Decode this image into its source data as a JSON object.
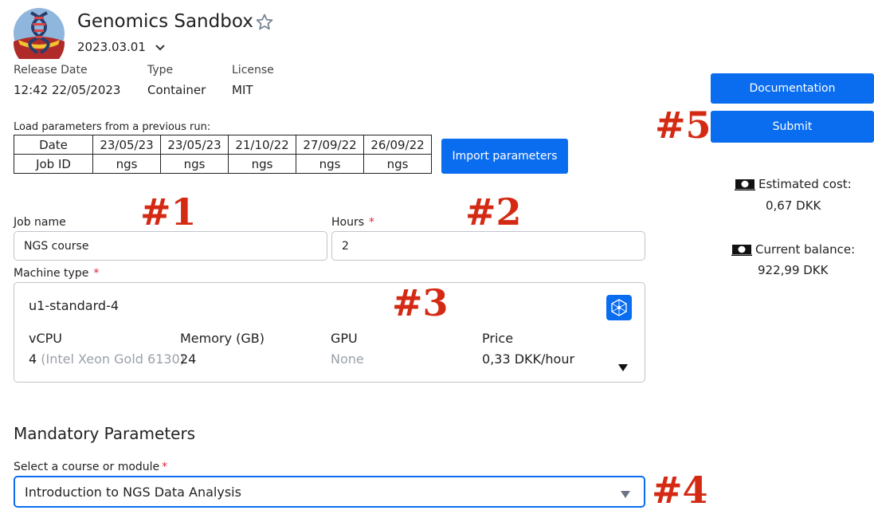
{
  "header": {
    "title": "Genomics Sandbox",
    "version": "2023.03.01"
  },
  "meta": {
    "release_date_label": "Release Date",
    "release_date_value": "12:42 22/05/2023",
    "type_label": "Type",
    "type_value": "Container",
    "license_label": "License",
    "license_value": "MIT"
  },
  "previous_runs": {
    "label": "Load parameters from a previous run:",
    "row_headers": [
      "Date",
      "Job ID"
    ],
    "dates": [
      "23/05/23",
      "23/05/23",
      "21/10/22",
      "27/09/22",
      "26/09/22"
    ],
    "job_ids": [
      "ngs",
      "ngs",
      "ngs",
      "ngs",
      "ngs"
    ],
    "import_button": "Import parameters"
  },
  "form": {
    "job_name_label": "Job name",
    "job_name_value": "NGS course",
    "hours_label": "Hours",
    "hours_value": "2",
    "required_mark": "*",
    "machine_type_label": "Machine type"
  },
  "machine": {
    "name": "u1-standard-4",
    "vcpu_label": "vCPU",
    "vcpu_value": "4",
    "vcpu_detail": "(Intel Xeon Gold 6130)",
    "memory_label": "Memory (GB)",
    "memory_value": "24",
    "gpu_label": "GPU",
    "gpu_value": "None",
    "price_label": "Price",
    "price_value": "0,33 DKK/hour"
  },
  "mandatory": {
    "title": "Mandatory Parameters",
    "course_label": "Select a course or module",
    "course_value": "Introduction to NGS Data Analysis"
  },
  "sidebar": {
    "documentation_button": "Documentation",
    "submit_button": "Submit",
    "estimated_cost_label": "Estimated cost:",
    "estimated_cost_value": "0,67 DKK",
    "current_balance_label": "Current balance:",
    "current_balance_value": "922,99 DKK"
  },
  "annotations": [
    "#1",
    "#2",
    "#3",
    "#4",
    "#5"
  ],
  "colors": {
    "primary": "#0a6df0",
    "annotation": "#d42a14",
    "required": "#e0243a"
  },
  "icons": [
    "dna-logo-icon",
    "star-icon",
    "chevron-down-icon",
    "machine-network-icon",
    "caret-down-icon",
    "banknote-icon"
  ]
}
